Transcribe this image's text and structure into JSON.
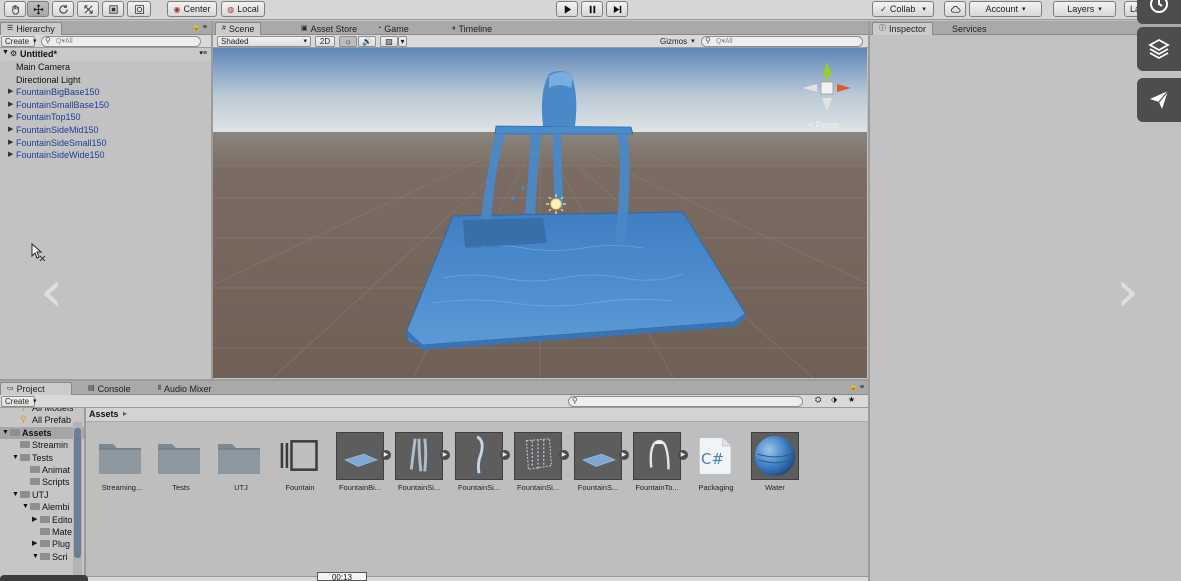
{
  "toolbar": {
    "tools": [
      "hand-tool",
      "move-tool",
      "rotate-tool",
      "scale-tool",
      "rect-tool",
      "transform-tool"
    ],
    "pivot_label": "Center",
    "space_label": "Local",
    "collab_label": "Collab",
    "account_label": "Account",
    "layers_label": "Layers",
    "layout_label": "La"
  },
  "hierarchy": {
    "tab_label": "Hierarchy",
    "create_label": "Create",
    "search_placeholder": "Q▾All",
    "scene_name": "Untitled*",
    "items": [
      {
        "label": "Main Camera",
        "prefab": false
      },
      {
        "label": "Directional Light",
        "prefab": false
      },
      {
        "label": "FountainBigBase150",
        "prefab": true
      },
      {
        "label": "FountainSmallBase150",
        "prefab": true
      },
      {
        "label": "FountainTop150",
        "prefab": true
      },
      {
        "label": "FountainSideMid150",
        "prefab": true
      },
      {
        "label": "FountainSideSmall150",
        "prefab": true
      },
      {
        "label": "FountainSideWide150",
        "prefab": true
      }
    ]
  },
  "scene_tabs": {
    "tabs": [
      "Scene",
      "Asset Store",
      "Game",
      "Timeline"
    ],
    "shading_label": "Shaded",
    "mode_2d_label": "2D",
    "gizmos_label": "Gizmos",
    "search_placeholder": "Q▾All",
    "persp_label": "< Persp"
  },
  "inspector": {
    "tabs": [
      "Inspector",
      "Services"
    ]
  },
  "project": {
    "tabs": [
      "Project",
      "Console",
      "Audio Mixer"
    ],
    "create_label": "Create",
    "breadcrumb": "Assets",
    "tree": [
      {
        "label": "All Models",
        "indent": 1,
        "type": "search"
      },
      {
        "label": "All Prefab",
        "indent": 1,
        "type": "search"
      },
      {
        "label": "Assets",
        "indent": 0,
        "type": "folder",
        "expanded": true,
        "selected": true
      },
      {
        "label": "Streamin",
        "indent": 1,
        "type": "folder"
      },
      {
        "label": "Tests",
        "indent": 1,
        "type": "folder",
        "expanded": true
      },
      {
        "label": "Animat",
        "indent": 2,
        "type": "folder"
      },
      {
        "label": "Scripts",
        "indent": 2,
        "type": "folder"
      },
      {
        "label": "UTJ",
        "indent": 1,
        "type": "folder",
        "expanded": true
      },
      {
        "label": "Alembi",
        "indent": 2,
        "type": "folder",
        "expanded": true
      },
      {
        "label": "Edito",
        "indent": 3,
        "type": "folder",
        "collapsed": true
      },
      {
        "label": "Mate",
        "indent": 3,
        "type": "folder"
      },
      {
        "label": "Plug",
        "indent": 3,
        "type": "folder",
        "collapsed": true
      },
      {
        "label": "Scri",
        "indent": 3,
        "type": "folder",
        "expanded": true
      }
    ],
    "assets": [
      {
        "label": "Streaming...",
        "kind": "folder"
      },
      {
        "label": "Tests",
        "kind": "folder"
      },
      {
        "label": "UTJ",
        "kind": "folder"
      },
      {
        "label": "Fountain",
        "kind": "timeline"
      },
      {
        "label": "FountainBi...",
        "kind": "mesh-flat"
      },
      {
        "label": "FountainSi...",
        "kind": "mesh-drip"
      },
      {
        "label": "FountainSi...",
        "kind": "mesh-stream"
      },
      {
        "label": "FountainSi...",
        "kind": "mesh-curtain"
      },
      {
        "label": "FountainS...",
        "kind": "mesh-flat"
      },
      {
        "label": "FountainTo...",
        "kind": "mesh-top"
      },
      {
        "label": "Packaging",
        "kind": "csharp"
      },
      {
        "label": "Water",
        "kind": "material"
      }
    ],
    "csharp_glyph": "C#"
  },
  "status": {
    "time_label": "00:13"
  },
  "overlay": {
    "prev_arrow": "‹",
    "next_arrow": "›"
  },
  "colors": {
    "water": "#4f8fd0",
    "ground": "#7a6a5e",
    "sky_top": "#6f95c4",
    "prefab_text": "#1d3e97",
    "panel_bg": "#c2c2c2"
  }
}
